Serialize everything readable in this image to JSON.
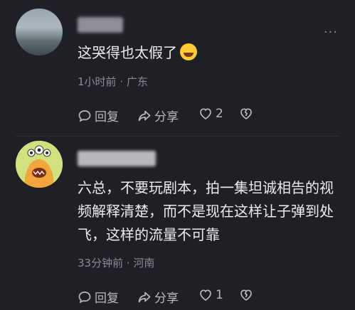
{
  "comments": [
    {
      "text": "这哭得也太假了",
      "emoji": "laughing-tears-emoji",
      "time": "1小时前",
      "location": "广东",
      "reply_label": "回复",
      "share_label": "分享",
      "likes": "2"
    },
    {
      "text": "六总，不要玩剧本，拍一集坦诚相告的视频解释清楚，而不是现在这样让子弹到处飞，这样的流量不可靠",
      "time": "33分钟前",
      "location": "河南",
      "reply_label": "回复",
      "share_label": "分享",
      "likes": "1"
    }
  ],
  "meta_separator": " · ",
  "colors": {
    "background": "#1f1f26",
    "text": "#ececf0",
    "secondary": "#8b8b93"
  }
}
